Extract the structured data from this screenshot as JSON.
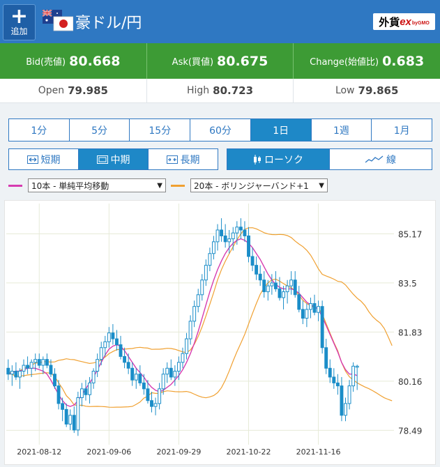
{
  "header": {
    "add_label": "追加",
    "add_icon": "plus-icon",
    "pair_title": "豪ドル/円",
    "brand_main": "外貨",
    "brand_ex": "ex",
    "brand_gmo": "byGMO",
    "flag_icon": "aud-jpy-flags-icon"
  },
  "quote": {
    "bid_label": "Bid(売値)",
    "bid_value": "80.668",
    "ask_label": "Ask(買値)",
    "ask_value": "80.675",
    "change_label": "Change(始値比)",
    "change_value": "0.683"
  },
  "ohl": {
    "open_label": "Open",
    "open_value": "79.985",
    "high_label": "High",
    "high_value": "80.723",
    "low_label": "Low",
    "low_value": "79.865"
  },
  "timeframes": {
    "items": [
      "1分",
      "5分",
      "15分",
      "60分",
      "1日",
      "1週",
      "1月"
    ],
    "active": "1日"
  },
  "term": {
    "short": "短期",
    "mid": "中期",
    "long": "長期",
    "active": "中期"
  },
  "chart_type": {
    "candle": "ローソク",
    "line": "線",
    "active": "ローソク"
  },
  "indicators": {
    "sma_select": "10本 - 単純平均移動",
    "sma_color": "#d63bb0",
    "bb_select": "20本 - ボリンジャーバンド+1",
    "bb_color": "#f0a030"
  },
  "colors": {
    "header_blue": "#2f78c2",
    "quote_green": "#3d9b35",
    "candle": "#1a8dc8",
    "active_tab": "#1e88c7"
  },
  "chart_data": {
    "type": "candlestick",
    "y_ticks": [
      "85.17",
      "83.5",
      "81.83",
      "80.16",
      "78.49"
    ],
    "ylim": [
      78.0,
      86.2
    ],
    "x_ticks": [
      "2021-08-12",
      "2021-09-06",
      "2021-09-29",
      "2021-10-22",
      "2021-11-16"
    ],
    "x_tick_index": [
      8,
      26,
      44,
      62,
      80
    ],
    "n_bars": 100,
    "ohlc": [
      [
        80.6,
        80.9,
        80.2,
        80.4
      ],
      [
        80.4,
        80.7,
        80.0,
        80.5
      ],
      [
        80.5,
        80.8,
        80.2,
        80.3
      ],
      [
        80.3,
        80.6,
        79.9,
        80.5
      ],
      [
        80.5,
        80.9,
        80.3,
        80.7
      ],
      [
        80.7,
        81.0,
        80.4,
        80.6
      ],
      [
        80.6,
        80.9,
        80.3,
        80.8
      ],
      [
        80.8,
        81.1,
        80.5,
        80.9
      ],
      [
        80.9,
        81.1,
        80.6,
        80.7
      ],
      [
        80.7,
        81.0,
        80.4,
        80.9
      ],
      [
        80.9,
        81.1,
        80.6,
        80.7
      ],
      [
        80.7,
        80.9,
        80.3,
        80.4
      ],
      [
        80.4,
        80.6,
        79.9,
        80.0
      ],
      [
        80.0,
        80.2,
        79.2,
        79.4
      ],
      [
        79.4,
        79.6,
        78.8,
        79.2
      ],
      [
        79.2,
        79.4,
        78.6,
        78.7
      ],
      [
        78.7,
        79.2,
        78.5,
        79.0
      ],
      [
        79.0,
        79.3,
        78.4,
        78.5
      ],
      [
        78.5,
        79.8,
        78.3,
        79.6
      ],
      [
        79.6,
        80.1,
        79.3,
        79.9
      ],
      [
        79.9,
        80.2,
        79.5,
        79.7
      ],
      [
        79.7,
        80.3,
        79.4,
        80.1
      ],
      [
        80.1,
        80.6,
        79.9,
        80.5
      ],
      [
        80.5,
        81.1,
        80.3,
        80.9
      ],
      [
        80.9,
        81.5,
        80.7,
        81.3
      ],
      [
        81.3,
        81.7,
        81.0,
        81.5
      ],
      [
        81.5,
        82.0,
        81.3,
        81.8
      ],
      [
        81.8,
        82.1,
        81.4,
        81.6
      ],
      [
        81.6,
        81.9,
        81.2,
        81.4
      ],
      [
        81.4,
        81.7,
        80.9,
        81.0
      ],
      [
        81.0,
        81.3,
        80.6,
        80.8
      ],
      [
        80.8,
        81.1,
        80.4,
        80.6
      ],
      [
        80.6,
        80.8,
        80.0,
        80.2
      ],
      [
        80.2,
        80.6,
        79.9,
        80.4
      ],
      [
        80.4,
        80.7,
        80.0,
        80.1
      ],
      [
        80.1,
        80.4,
        79.7,
        79.9
      ],
      [
        79.9,
        80.2,
        79.4,
        79.5
      ],
      [
        79.5,
        79.8,
        79.1,
        79.3
      ],
      [
        79.3,
        79.6,
        79.0,
        79.4
      ],
      [
        79.4,
        80.1,
        79.2,
        79.9
      ],
      [
        79.9,
        80.6,
        79.7,
        80.4
      ],
      [
        80.4,
        80.8,
        80.1,
        80.6
      ],
      [
        80.6,
        80.9,
        80.2,
        80.3
      ],
      [
        80.3,
        80.7,
        80.0,
        80.5
      ],
      [
        80.5,
        81.0,
        80.2,
        80.8
      ],
      [
        80.8,
        81.3,
        80.6,
        81.1
      ],
      [
        81.1,
        81.8,
        80.9,
        81.6
      ],
      [
        81.6,
        82.4,
        81.4,
        82.2
      ],
      [
        82.2,
        82.9,
        82.0,
        82.7
      ],
      [
        82.7,
        83.3,
        82.5,
        83.1
      ],
      [
        83.1,
        83.8,
        82.9,
        83.6
      ],
      [
        83.6,
        84.3,
        83.4,
        84.1
      ],
      [
        84.1,
        84.7,
        83.9,
        84.5
      ],
      [
        84.5,
        85.1,
        84.3,
        84.9
      ],
      [
        84.9,
        85.5,
        84.6,
        85.3
      ],
      [
        85.3,
        85.7,
        84.9,
        85.1
      ],
      [
        85.1,
        85.5,
        84.7,
        84.9
      ],
      [
        84.9,
        85.3,
        84.5,
        85.0
      ],
      [
        85.0,
        85.4,
        84.6,
        85.2
      ],
      [
        85.2,
        85.6,
        84.8,
        85.4
      ],
      [
        85.4,
        85.7,
        85.0,
        85.3
      ],
      [
        85.3,
        85.6,
        84.9,
        85.1
      ],
      [
        85.1,
        85.4,
        84.2,
        84.4
      ],
      [
        84.4,
        84.7,
        83.9,
        84.1
      ],
      [
        84.1,
        84.4,
        83.6,
        83.8
      ],
      [
        83.8,
        84.1,
        83.4,
        83.6
      ],
      [
        83.6,
        83.9,
        83.0,
        83.2
      ],
      [
        83.2,
        83.6,
        82.9,
        83.4
      ],
      [
        83.4,
        83.8,
        83.1,
        83.5
      ],
      [
        83.5,
        83.9,
        83.2,
        83.3
      ],
      [
        83.3,
        83.7,
        82.9,
        83.0
      ],
      [
        83.0,
        83.4,
        82.6,
        83.2
      ],
      [
        83.2,
        83.6,
        82.8,
        83.4
      ],
      [
        83.4,
        83.9,
        83.1,
        83.6
      ],
      [
        83.6,
        83.9,
        83.0,
        83.1
      ],
      [
        83.1,
        83.4,
        82.5,
        82.6
      ],
      [
        82.6,
        82.9,
        82.1,
        82.3
      ],
      [
        82.3,
        82.8,
        82.0,
        82.6
      ],
      [
        82.6,
        83.0,
        82.3,
        82.8
      ],
      [
        82.8,
        83.1,
        82.4,
        82.5
      ],
      [
        82.5,
        82.9,
        82.2,
        82.7
      ],
      [
        82.7,
        82.9,
        81.1,
        81.3
      ],
      [
        81.3,
        81.6,
        80.4,
        80.6
      ],
      [
        80.6,
        80.9,
        80.1,
        80.3
      ],
      [
        80.3,
        80.6,
        79.9,
        80.1
      ],
      [
        80.1,
        80.4,
        79.7,
        80.0
      ],
      [
        80.0,
        80.3,
        78.8,
        79.0
      ],
      [
        79.0,
        79.6,
        78.8,
        79.4
      ],
      [
        79.4,
        80.2,
        79.2,
        80.0
      ],
      [
        80.0,
        80.8,
        79.8,
        80.67
      ],
      [
        80.67,
        80.72,
        79.86,
        80.67
      ]
    ],
    "sma10": [
      80.4,
      80.45,
      80.5,
      80.5,
      80.55,
      80.6,
      80.6,
      80.6,
      80.55,
      80.5,
      80.4,
      80.2,
      79.95,
      79.7,
      79.5,
      79.35,
      79.3,
      79.35,
      79.5,
      79.7,
      79.9,
      80.1,
      80.3,
      80.55,
      80.8,
      81.05,
      81.25,
      81.35,
      81.4,
      81.35,
      81.2,
      81.0,
      80.8,
      80.6,
      80.45,
      80.3,
      80.1,
      79.95,
      79.85,
      79.8,
      79.85,
      79.95,
      80.05,
      80.2,
      80.35,
      80.55,
      80.8,
      81.1,
      81.45,
      81.85,
      82.3,
      82.75,
      83.2,
      83.6,
      83.95,
      84.25,
      84.5,
      84.7,
      84.85,
      84.95,
      85.0,
      84.95,
      84.85,
      84.7,
      84.5,
      84.3,
      84.05,
      83.8,
      83.6,
      83.45,
      83.35,
      83.3,
      83.3,
      83.3,
      83.25,
      83.15,
      83.0,
      82.85,
      82.75,
      82.7,
      82.6,
      82.35,
      82.05,
      81.75,
      81.45,
      81.15,
      80.8,
      80.55,
      80.4,
      80.4,
      80.35
    ]
  }
}
